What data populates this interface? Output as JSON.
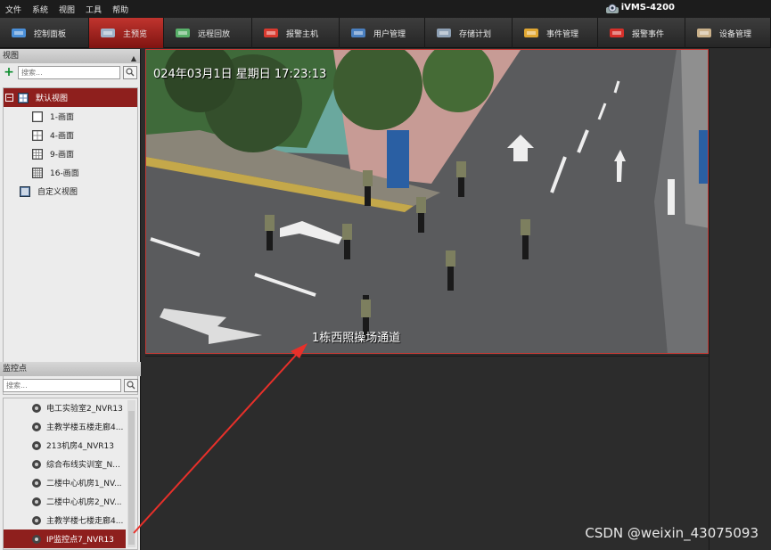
{
  "menu": [
    "文件",
    "系统",
    "视图",
    "工具",
    "帮助"
  ],
  "brand": "iVMS-4200",
  "toolbar": [
    {
      "label": "控制面板",
      "icon": "control-panel-icon",
      "width": 100,
      "active": false
    },
    {
      "label": "主预览",
      "icon": "main-preview-icon",
      "width": 84,
      "active": true
    },
    {
      "label": "远程回放",
      "icon": "remote-playback-icon",
      "width": 99,
      "active": false
    },
    {
      "label": "报警主机",
      "icon": "alarm-host-icon",
      "width": 98,
      "active": false
    },
    {
      "label": "用户管理",
      "icon": "user-manage-icon",
      "width": 96,
      "active": false
    },
    {
      "label": "存储计划",
      "icon": "storage-plan-icon",
      "width": 98,
      "active": false
    },
    {
      "label": "事件管理",
      "icon": "event-manage-icon",
      "width": 96,
      "active": false
    },
    {
      "label": "报警事件",
      "icon": "alarm-event-icon",
      "width": 98,
      "active": false
    },
    {
      "label": "设备管理",
      "icon": "device-manage-icon",
      "width": 96,
      "active": false
    }
  ],
  "views_panel": {
    "title": "视图",
    "search_placeholder": "搜索...",
    "default_view": "默认视图",
    "layouts": [
      "1-画面",
      "4-画面",
      "9-画面",
      "16-画面"
    ],
    "custom_view": "自定义视图"
  },
  "monitor_panel": {
    "title": "监控点",
    "search_placeholder": "搜索...",
    "cameras": [
      "电工实验室2_NVR13",
      "主教学楼五楼走廊4...",
      "213机房4_NVR13",
      "综合布线实训室_N...",
      "二楼中心机房1_NV...",
      "二楼中心机房2_NV...",
      "主教学楼七楼走廊4...",
      "IP监控点7_NVR13"
    ],
    "selected_camera": 7
  },
  "video": {
    "osd_time": "024年03月1日 星期日 17:23:13",
    "osd_name": "1栋西照操场通道"
  },
  "watermark": "CSDN @weixin_43075093",
  "colors": {
    "accent": "#8e1f1d",
    "active_tab": "#c0342e",
    "border_active": "#c43a35",
    "arrow": "#e8302a"
  }
}
